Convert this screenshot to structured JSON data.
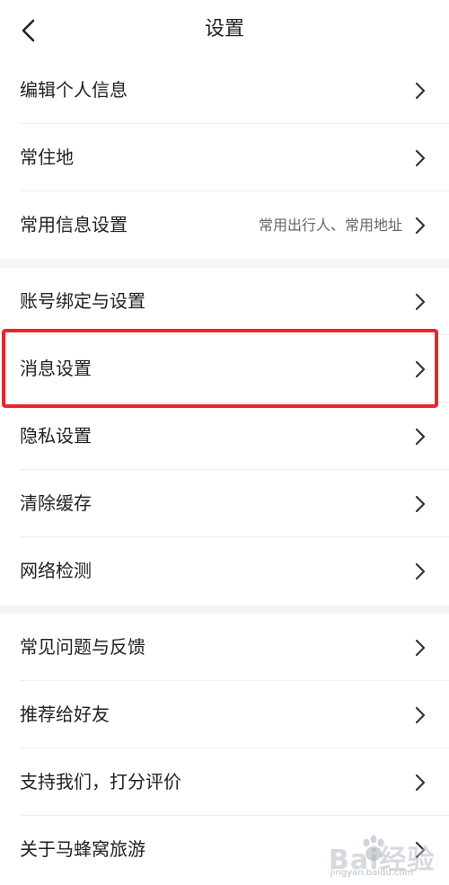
{
  "header": {
    "title": "设置"
  },
  "groups": [
    {
      "items": [
        {
          "label": "编辑个人信息"
        },
        {
          "label": "常住地"
        },
        {
          "label": "常用信息设置",
          "value": "常用出行人、常用地址"
        }
      ]
    },
    {
      "items": [
        {
          "label": "账号绑定与设置"
        },
        {
          "label": "消息设置",
          "highlighted": true
        },
        {
          "label": "隐私设置"
        },
        {
          "label": "清除缓存"
        },
        {
          "label": "网络检测"
        }
      ]
    },
    {
      "items": [
        {
          "label": "常见问题与反馈"
        },
        {
          "label": "推荐给好友"
        },
        {
          "label": "支持我们，打分评价"
        },
        {
          "label": "关于马蜂窝旅游"
        }
      ]
    }
  ],
  "watermark": {
    "text": "Bai经验",
    "sub": "jingyan.baidu.com"
  },
  "colors": {
    "highlight": "#e8262b",
    "separator": "#f4f5f7",
    "chevron": "#333333"
  }
}
